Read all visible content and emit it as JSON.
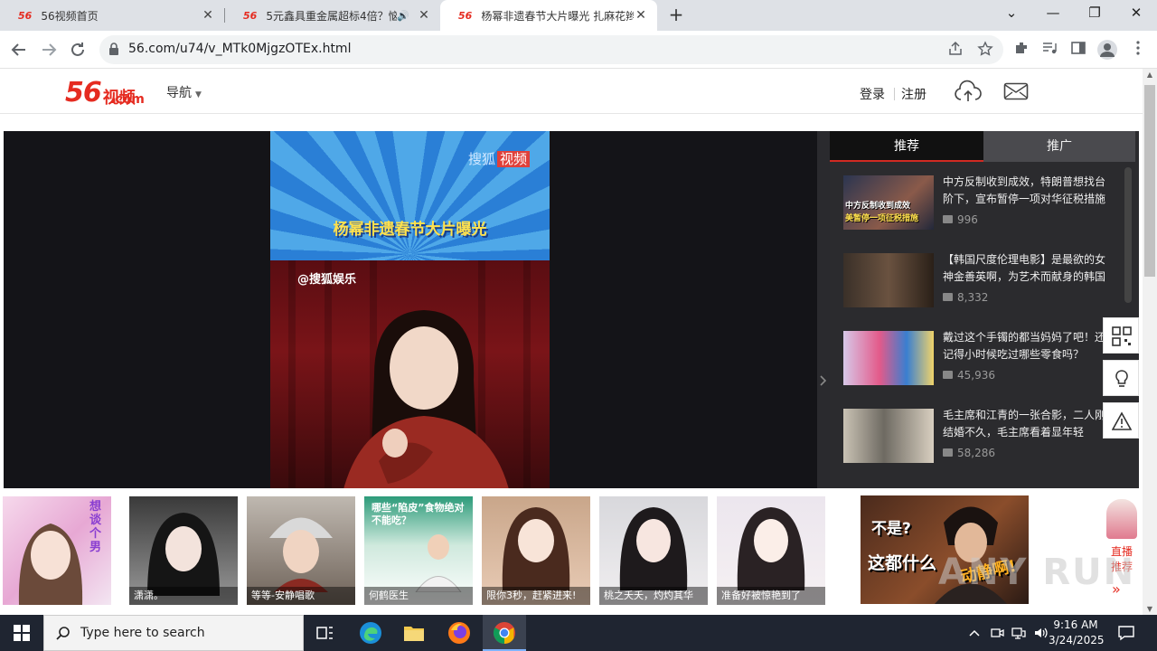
{
  "browser": {
    "tabs": [
      {
        "favicon": "56",
        "title": "56视频首页",
        "close": "✕"
      },
      {
        "favicon": "56",
        "title": "5元鑫具重金属超标4倍？恼",
        "audio": "🔊",
        "close": "✕"
      },
      {
        "favicon": "56",
        "title": "杨幂非遗春节大片曝光 扎麻花辫",
        "close": "✕"
      }
    ],
    "new_tab": "+",
    "window_controls": {
      "dropdown": "⌄",
      "minimize": "—",
      "restore": "❐",
      "close": "✕"
    },
    "url": "56.com/u74/v_MTk0MjgzOTEx.html"
  },
  "site": {
    "logo_number": "56",
    "logo_text": "视频",
    "logo_com": ".com",
    "nav_label": "导航",
    "login": "登录",
    "register": "注册"
  },
  "video": {
    "brand_prefix": "搜狐",
    "brand_suffix": "视频",
    "title": "杨幂非遗春节大片曝光",
    "handle": "@搜狐娱乐"
  },
  "recommend": {
    "tabs": [
      "推荐",
      "推广"
    ],
    "items": [
      {
        "title": "中方反制收到成效，特朗普想找台阶下，宣布暂停一项对华征税措施",
        "views": "996"
      },
      {
        "title": "【韩国尺度伦理电影】是最欲的女神金善英啊，为艺术而献身的韩国",
        "views": "8,332"
      },
      {
        "title": "戴过这个手镯的都当妈妈了吧！还记得小时候吃过哪些零食吗？",
        "views": "45,936"
      },
      {
        "title": "毛主席和江青的一张合影，二人刚结婚不久，毛主席看着显年轻",
        "views": "58,286"
      }
    ],
    "thumb_captions": [
      "中方反制收到成效",
      "美暂停一项征税措施"
    ]
  },
  "strip": {
    "cards": [
      {
        "caption": "",
        "tag": "想谈个男"
      },
      {
        "caption": "潇潇。"
      },
      {
        "caption": "等等-安静唱歌"
      },
      {
        "caption": "何鹤医生",
        "tag": "哪些“陷皮”食物绝对不能吃？"
      },
      {
        "caption": "限你3秒，赶紧进来!"
      },
      {
        "caption": "桃之夭夭，灼灼其华"
      },
      {
        "caption": "准备好被惊艳到了"
      }
    ],
    "promo": {
      "line1": "不是?",
      "line2": "这都什么",
      "line3": "动静啊!"
    },
    "live_label": "直播推荐",
    "live_more": "»"
  },
  "watermark": "ANY RUN",
  "taskbar": {
    "search_placeholder": "Type here to search",
    "time": "9:16 AM",
    "date": "3/24/2025"
  },
  "colors": {
    "brand_red": "#e52b20",
    "panel_dark": "#2b2b2e",
    "taskbar": "#1f2531"
  }
}
